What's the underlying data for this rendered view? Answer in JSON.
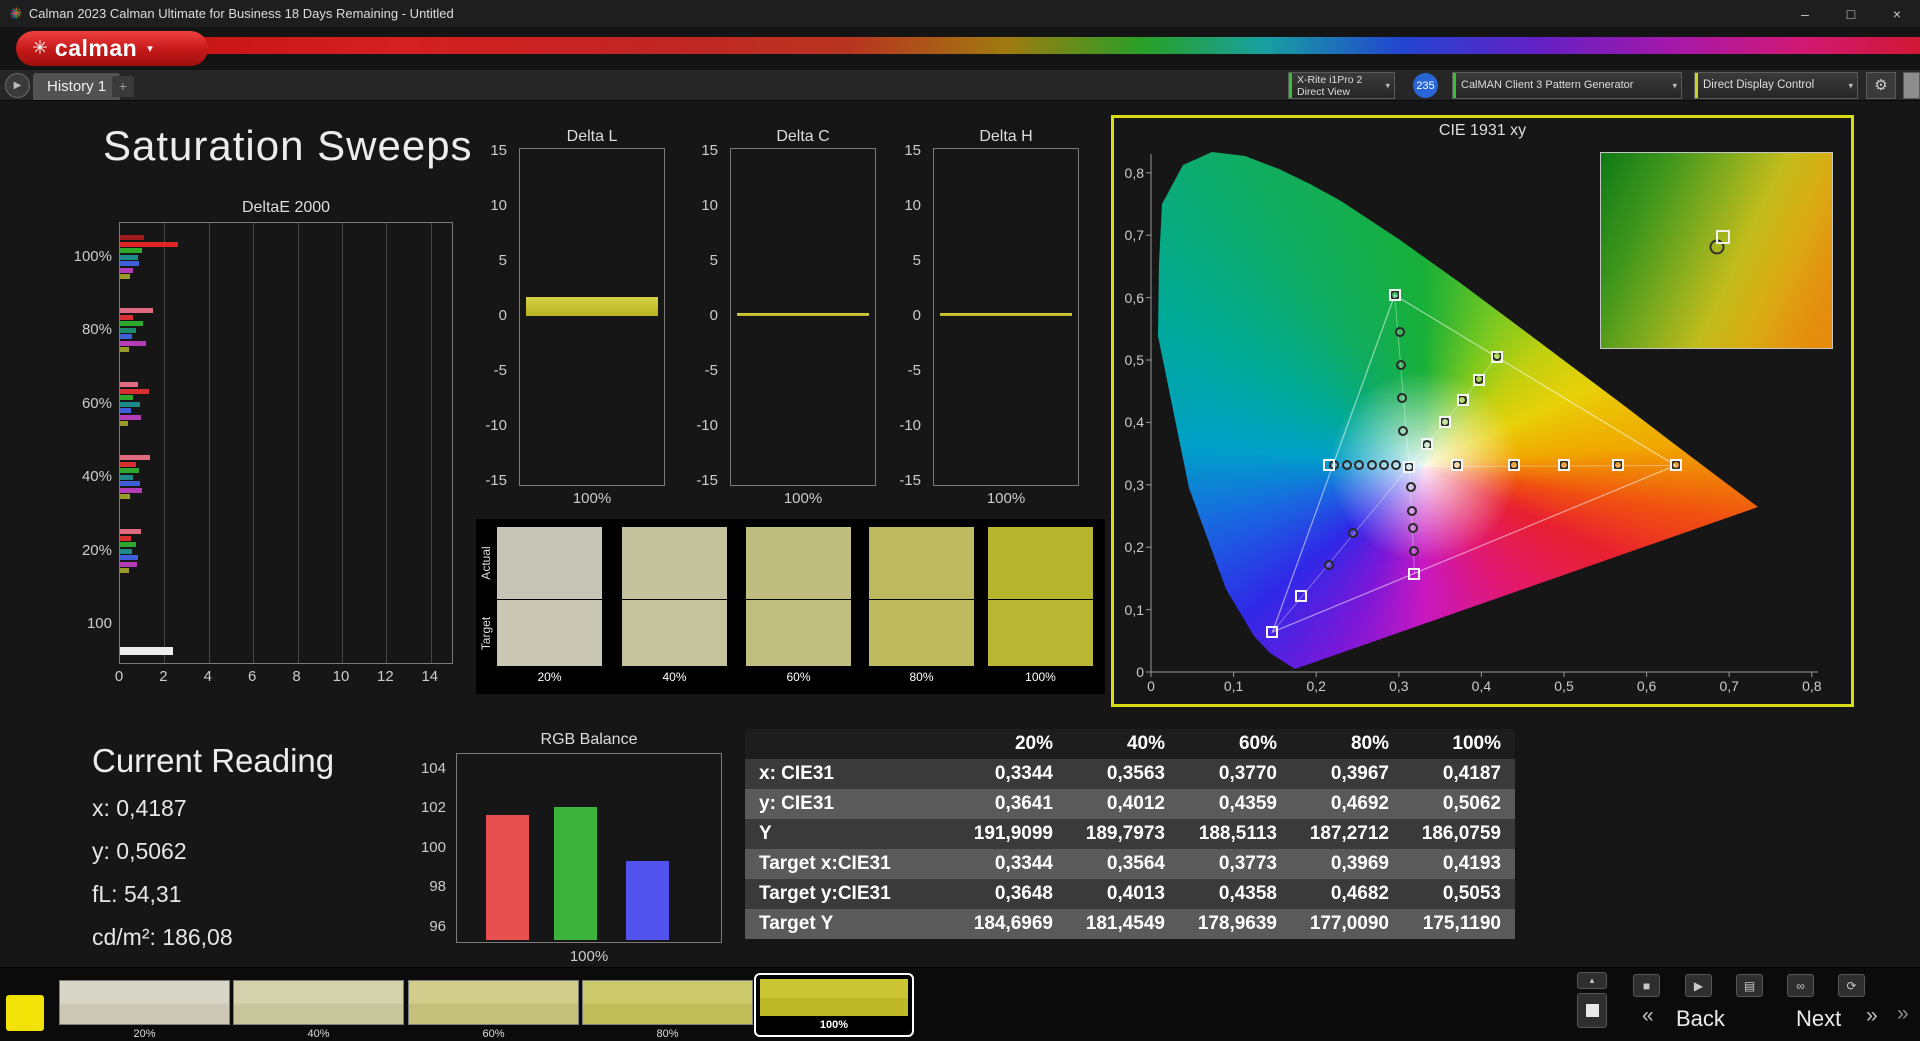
{
  "titlebar": {
    "title": "Calman 2023 Calman Ultimate for Business 18 Days Remaining  - Untitled"
  },
  "logo": {
    "text": "calman"
  },
  "tabbar": {
    "tab": "History 1",
    "add": "+"
  },
  "devices": {
    "meter_line1": "X-Rite i1Pro 2",
    "meter_line2": "Direct View",
    "badge": "235",
    "pattern_gen": "CalMAN Client 3 Pattern Generator",
    "display_ctrl": "Direct Display Control"
  },
  "page": {
    "title": "Saturation Sweeps"
  },
  "current_reading": {
    "title": "Current Reading",
    "x": "x: 0,4187",
    "y": "y: 0,5062",
    "fl": "fL: 54,31",
    "cdm2": "cd/m²: 186,08"
  },
  "swatch_strip": {
    "row_labels": [
      "Actual",
      "Target"
    ],
    "columns": [
      {
        "label": "20%",
        "actual": "#c7c5b5",
        "target": "#c9c7b4"
      },
      {
        "label": "40%",
        "actual": "#c4c29c",
        "target": "#c5c39b"
      },
      {
        "label": "60%",
        "actual": "#c0bd81",
        "target": "#c1bf80"
      },
      {
        "label": "80%",
        "actual": "#bcb95f",
        "target": "#bebb5e"
      },
      {
        "label": "100%",
        "actual": "#b7b42e",
        "target": "#bab734"
      }
    ]
  },
  "results_table": {
    "headers": [
      "",
      "20%",
      "40%",
      "60%",
      "80%",
      "100%"
    ],
    "rows": [
      {
        "label": "x: CIE31",
        "values": [
          "0,3344",
          "0,3563",
          "0,3770",
          "0,3967",
          "0,4187"
        ]
      },
      {
        "label": "y: CIE31",
        "values": [
          "0,3641",
          "0,4012",
          "0,4359",
          "0,4692",
          "0,5062"
        ]
      },
      {
        "label": "Y",
        "values": [
          "191,9099",
          "189,7973",
          "188,5113",
          "187,2712",
          "186,0759"
        ]
      },
      {
        "label": "Target x:CIE31",
        "values": [
          "0,3344",
          "0,3564",
          "0,3773",
          "0,3969",
          "0,4193"
        ]
      },
      {
        "label": "Target y:CIE31",
        "values": [
          "0,3648",
          "0,4013",
          "0,4358",
          "0,4682",
          "0,5053"
        ]
      },
      {
        "label": "Target Y",
        "values": [
          "184,6969",
          "181,4549",
          "178,9639",
          "177,0090",
          "175,1190"
        ]
      }
    ]
  },
  "bottom_bar": {
    "back_label": "Back",
    "next_label": "Next",
    "swatches": [
      {
        "label": "20%",
        "top": "#d8d6c6",
        "bottom": "#cbc9b6",
        "selected": false
      },
      {
        "label": "40%",
        "top": "#d4d2ad",
        "bottom": "#c8c69c",
        "selected": false
      },
      {
        "label": "60%",
        "top": "#d0cd8d",
        "bottom": "#c4c17b",
        "selected": false
      },
      {
        "label": "80%",
        "top": "#ccc96a",
        "bottom": "#c0bd58",
        "selected": false
      },
      {
        "label": "100%",
        "top": "#c9c533",
        "bottom": "#bdb927",
        "selected": true
      }
    ]
  },
  "icons": {
    "app": "✳",
    "logo_mark": "✳",
    "dropdown_caret": "▾",
    "tab_play": "▶",
    "minimize": "–",
    "maximize": "□",
    "close": "×",
    "gear": "⚙",
    "up_chevron": "▴",
    "stop": "■",
    "play": "▶",
    "save": "▤",
    "link": "∞",
    "refresh": "⟳",
    "back_chevrons": "«",
    "next_chevrons": "»",
    "edge_chevron": "»"
  },
  "colors": {
    "panel_highlight": "#d8dc14",
    "badge_blue": "#2866d8",
    "logo_red": "#c41818"
  },
  "chart_data": [
    {
      "id": "deltae2000",
      "type": "bar",
      "orientation": "horizontal",
      "title": "DeltaE 2000",
      "xlim": [
        0,
        14
      ],
      "xticks": [
        0,
        2,
        4,
        6,
        8,
        10,
        12,
        14
      ],
      "group_labels": [
        "100%",
        "80%",
        "60%",
        "40%",
        "20%",
        "100"
      ],
      "groups": [
        {
          "label": "100%",
          "bars": [
            {
              "color": "#a01c1c",
              "value": 1.1
            },
            {
              "color": "#e02525",
              "value": 2.6
            },
            {
              "color": "#2da82d",
              "value": 1.0
            },
            {
              "color": "#1d8a8a",
              "value": 0.8
            },
            {
              "color": "#3f5fd8",
              "value": 0.85
            },
            {
              "color": "#b43cb4",
              "value": 0.6
            },
            {
              "color": "#9a9a2a",
              "value": 0.45
            }
          ]
        },
        {
          "label": "80%",
          "bars": [
            {
              "color": "#e06a80",
              "value": 1.5
            },
            {
              "color": "#d83030",
              "value": 0.6
            },
            {
              "color": "#2da82d",
              "value": 1.05
            },
            {
              "color": "#1d8a6a",
              "value": 0.7
            },
            {
              "color": "#3f5fd8",
              "value": 0.55
            },
            {
              "color": "#b43cb4",
              "value": 1.15
            },
            {
              "color": "#9a9a2a",
              "value": 0.4
            }
          ]
        },
        {
          "label": "60%",
          "bars": [
            {
              "color": "#e06a80",
              "value": 0.8
            },
            {
              "color": "#d83030",
              "value": 1.3
            },
            {
              "color": "#2da82d",
              "value": 0.6
            },
            {
              "color": "#1d8a8a",
              "value": 0.9
            },
            {
              "color": "#3f5fd8",
              "value": 0.5
            },
            {
              "color": "#b43cb4",
              "value": 0.95
            },
            {
              "color": "#9a9a2a",
              "value": 0.35
            }
          ]
        },
        {
          "label": "40%",
          "bars": [
            {
              "color": "#e06a80",
              "value": 1.35
            },
            {
              "color": "#d83030",
              "value": 0.7
            },
            {
              "color": "#2da82d",
              "value": 0.85
            },
            {
              "color": "#1d8a8a",
              "value": 0.6
            },
            {
              "color": "#3f5fd8",
              "value": 0.9
            },
            {
              "color": "#b43cb4",
              "value": 1.0
            },
            {
              "color": "#9a9a2a",
              "value": 0.45
            }
          ]
        },
        {
          "label": "20%",
          "bars": [
            {
              "color": "#e06a80",
              "value": 0.95
            },
            {
              "color": "#d83030",
              "value": 0.5
            },
            {
              "color": "#2da82d",
              "value": 0.7
            },
            {
              "color": "#1d8a8a",
              "value": 0.55
            },
            {
              "color": "#3f5fd8",
              "value": 0.8
            },
            {
              "color": "#b43cb4",
              "value": 0.75
            },
            {
              "color": "#9a9a2a",
              "value": 0.4
            }
          ]
        },
        {
          "label": "100",
          "bars": [
            {
              "color": "#ededed",
              "value": 2.4
            }
          ]
        }
      ]
    },
    {
      "id": "delta_l",
      "type": "bar",
      "title": "Delta L",
      "ylim": [
        -15,
        15
      ],
      "yticks": [
        15,
        10,
        5,
        0,
        -5,
        -10,
        -15
      ],
      "xlabel": "100%",
      "values": [
        1.7
      ],
      "bar_color": "#c9c52e"
    },
    {
      "id": "delta_c",
      "type": "bar",
      "title": "Delta C",
      "ylim": [
        -15,
        15
      ],
      "yticks": [
        15,
        10,
        5,
        0,
        -5,
        -10,
        -15
      ],
      "xlabel": "100%",
      "values": [
        0.12
      ],
      "bar_color": "#c9c52e"
    },
    {
      "id": "delta_h",
      "type": "bar",
      "title": "Delta H",
      "ylim": [
        -15,
        15
      ],
      "yticks": [
        15,
        10,
        5,
        0,
        -5,
        -10,
        -15
      ],
      "xlabel": "100%",
      "values": [
        0.18
      ],
      "bar_color": "#c9c52e"
    },
    {
      "id": "cie1931",
      "type": "scatter",
      "title": "CIE 1931 xy",
      "xlim": [
        0,
        0.8
      ],
      "ylim": [
        0,
        0.8
      ],
      "x_tick_labels": [
        "0",
        "0,1",
        "0,2",
        "0,3",
        "0,4",
        "0,5",
        "0,6",
        "0,7",
        "0,8"
      ],
      "y_tick_labels": [
        "0",
        "0,1",
        "0,2",
        "0,3",
        "0,4",
        "0,5",
        "0,6",
        "0,7",
        "0,8"
      ],
      "white_point": [
        0.3127,
        0.329
      ],
      "gamut_triangle": [
        [
          0.635,
          0.331
        ],
        [
          0.295,
          0.604
        ],
        [
          0.147,
          0.064
        ]
      ],
      "sweep_lines": [
        [
          0.635,
          0.331
        ],
        [
          0.295,
          0.604
        ],
        [
          0.147,
          0.064
        ],
        [
          0.216,
          0.332
        ],
        [
          0.319,
          0.157
        ],
        [
          0.4193,
          0.5053
        ]
      ],
      "targets": [
        [
          0.3127,
          0.329
        ],
        [
          0.216,
          0.332
        ],
        [
          0.37,
          0.331
        ],
        [
          0.44,
          0.331
        ],
        [
          0.5,
          0.331
        ],
        [
          0.565,
          0.331
        ],
        [
          0.635,
          0.331
        ],
        [
          0.295,
          0.604
        ],
        [
          0.182,
          0.121
        ],
        [
          0.147,
          0.064
        ],
        [
          0.319,
          0.157
        ],
        [
          0.3344,
          0.3648
        ],
        [
          0.3564,
          0.4013
        ],
        [
          0.3773,
          0.4358
        ],
        [
          0.3969,
          0.4682
        ],
        [
          0.4193,
          0.5053
        ]
      ],
      "measurements": [
        [
          0.3127,
          0.329
        ],
        [
          0.222,
          0.332
        ],
        [
          0.237,
          0.332
        ],
        [
          0.252,
          0.332
        ],
        [
          0.267,
          0.332
        ],
        [
          0.282,
          0.332
        ],
        [
          0.297,
          0.332
        ],
        [
          0.302,
          0.545
        ],
        [
          0.303,
          0.492
        ],
        [
          0.304,
          0.439
        ],
        [
          0.305,
          0.386
        ],
        [
          0.315,
          0.296
        ],
        [
          0.316,
          0.258
        ],
        [
          0.317,
          0.231
        ],
        [
          0.318,
          0.194
        ],
        [
          0.244,
          0.223
        ],
        [
          0.215,
          0.172
        ],
        [
          0.37,
          0.331
        ],
        [
          0.44,
          0.331
        ],
        [
          0.5,
          0.331
        ],
        [
          0.565,
          0.331
        ],
        [
          0.635,
          0.331
        ],
        [
          0.295,
          0.604
        ],
        [
          0.3344,
          0.3641
        ],
        [
          0.3563,
          0.4012
        ],
        [
          0.377,
          0.4359
        ],
        [
          0.3967,
          0.4692
        ],
        [
          0.4187,
          0.5062
        ]
      ],
      "inset_marker": [
        0.419,
        0.506
      ]
    },
    {
      "id": "rgb_balance",
      "type": "bar",
      "title": "RGB Balance",
      "ylim": [
        96,
        104
      ],
      "yticks": [
        104,
        102,
        100,
        98,
        96
      ],
      "xlabel": "100%",
      "categories": [
        "Red",
        "Green",
        "Blue"
      ],
      "values": [
        101.7,
        102.1,
        99.4
      ],
      "colors": [
        "#e85050",
        "#3cb43c",
        "#5252ee"
      ]
    }
  ]
}
